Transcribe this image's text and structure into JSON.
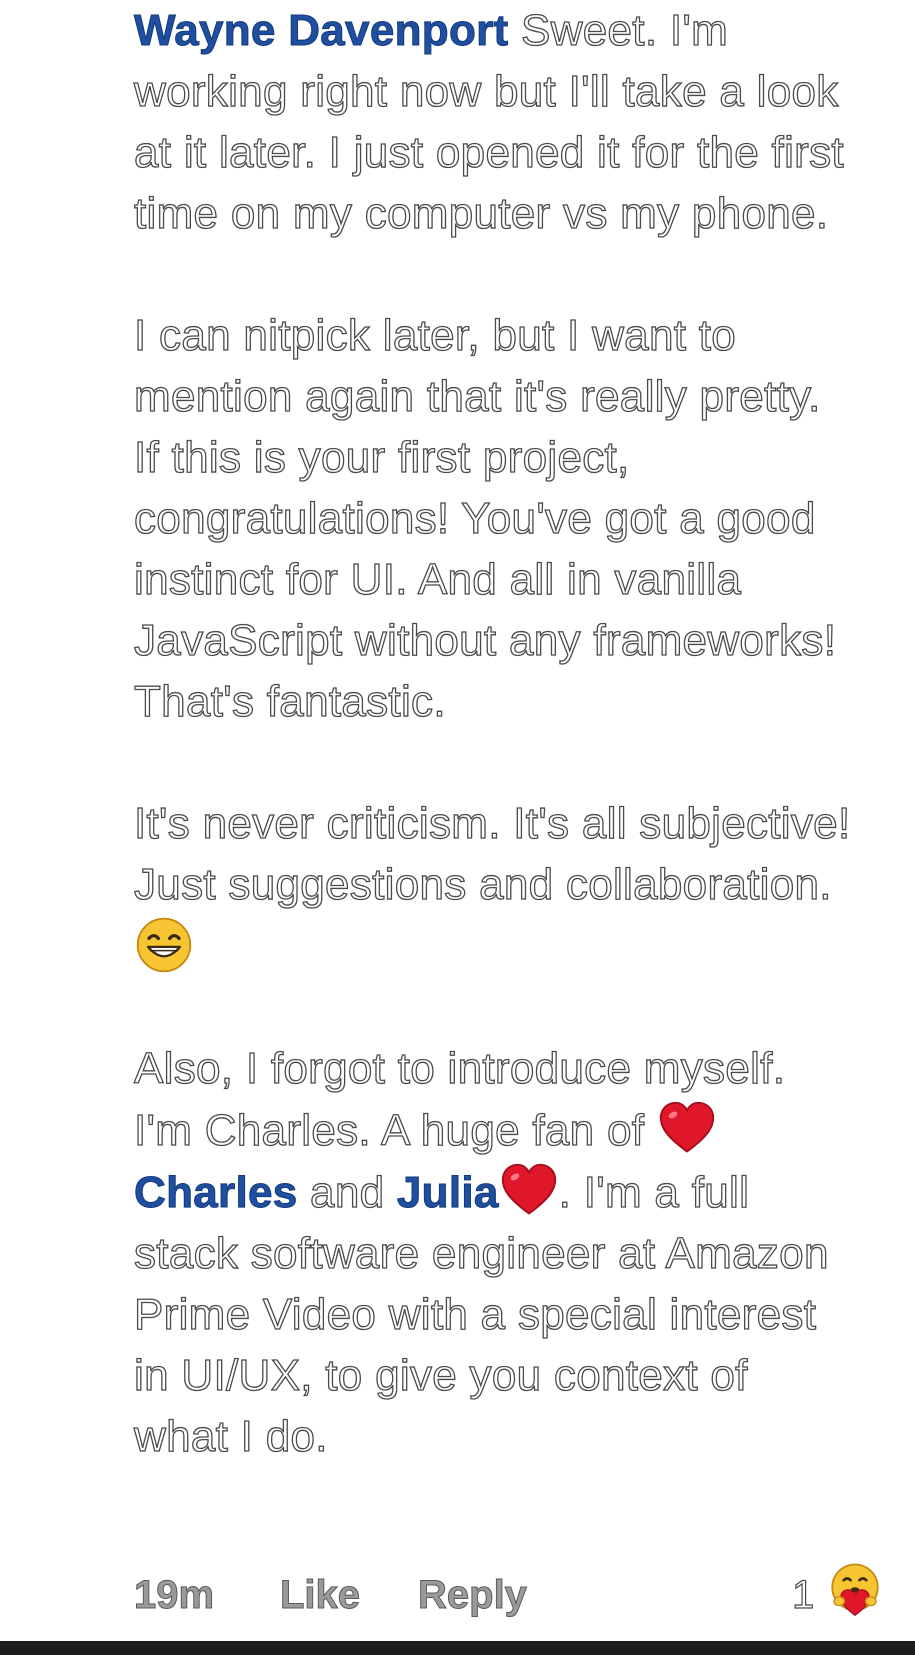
{
  "comment": {
    "author": "Wayne Davenport",
    "paragraph_1": "Sweet. I'm working right now but I'll take a look at it later. I just opened it for the first time on my computer vs my phone.",
    "paragraph_2": "I can nitpick later, but I want to mention again that it's really pretty. If this is your first project, congratulations! You've got a good instinct for UI. And all in vanilla JavaScript without any frameworks! That's fantastic.",
    "paragraph_3": "It's never criticism. It's all subjective! Just suggestions and collaboration.",
    "paragraph_3_emoji": "grinning-face-emoji",
    "paragraph_4_a": "Also, I forgot to introduce myself. I'm Charles. A huge fan of",
    "mention_1": "Charles",
    "paragraph_4_b": "and",
    "mention_2": "Julia",
    "paragraph_4_c": ". I'm a full stack software engineer at Amazon Prime Video with a special interest in UI/UX, to give you context of what I do.",
    "heart_emoji": "red-heart-emoji"
  },
  "footer": {
    "time": "19m",
    "like_label": "Like",
    "reply_label": "Reply",
    "reaction_count": "1",
    "reaction_icon": "care-reaction-icon"
  },
  "colors": {
    "mention_blue": "#1f4fa0",
    "text_outline": "#4a4a4a",
    "footer_gray": "#9a9a9a",
    "heart_red": "#e0162b",
    "emoji_yellow": "#f7c531",
    "bottom_bar": "#1c1d1f"
  }
}
